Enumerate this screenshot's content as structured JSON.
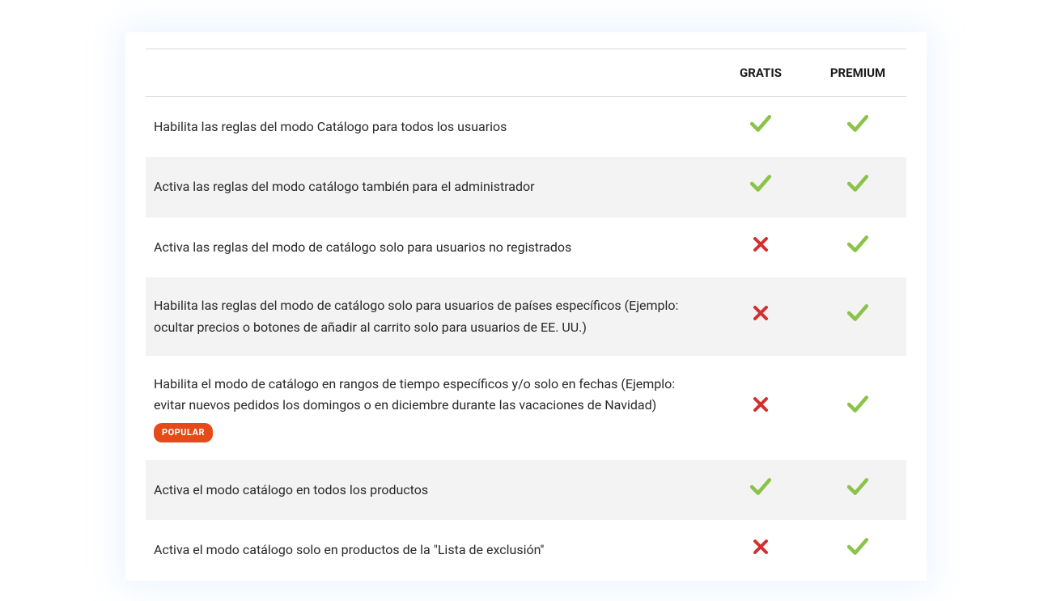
{
  "columns": {
    "feature": "",
    "free": "GRATIS",
    "premium": "PREMIUM"
  },
  "badge_label": "POPULAR",
  "rows": [
    {
      "feature": "Habilita las reglas del modo Catálogo para todos los usuarios",
      "badge": false,
      "free": "check",
      "premium": "check"
    },
    {
      "feature": "Activa las reglas del modo catálogo también para el administrador",
      "badge": false,
      "free": "check",
      "premium": "check"
    },
    {
      "feature": "Activa las reglas del modo de catálogo solo para usuarios no registrados",
      "badge": false,
      "free": "cross",
      "premium": "check"
    },
    {
      "feature": "Habilita las reglas del modo de catálogo solo para usuarios de países específicos (Ejemplo: ocultar precios o botones de añadir al carrito solo para usuarios de EE. UU.)",
      "badge": false,
      "free": "cross",
      "premium": "check"
    },
    {
      "feature": "Habilita el modo de catálogo en rangos de tiempo específicos y/o solo en fechas (Ejemplo: evitar nuevos pedidos los domingos o en diciembre durante las vacaciones de Navidad)",
      "badge": true,
      "free": "cross",
      "premium": "check"
    },
    {
      "feature": "Activa el modo catálogo en todos los productos",
      "badge": false,
      "free": "check",
      "premium": "check"
    },
    {
      "feature": "Activa el modo catálogo solo en productos de la \"Lista de exclusión''",
      "badge": false,
      "free": "cross",
      "premium": "check"
    }
  ]
}
